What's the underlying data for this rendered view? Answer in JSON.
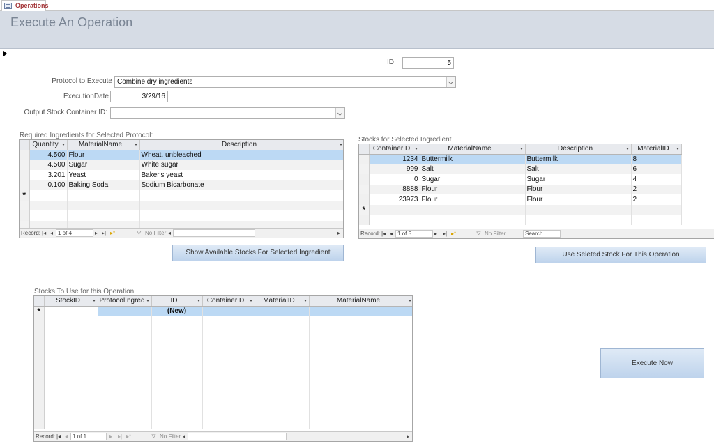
{
  "tab": {
    "label": "Operations",
    "icon": "form-icon"
  },
  "header": {
    "title": "Execute An Operation"
  },
  "fields": {
    "id_label": "ID",
    "id_value": "5",
    "protocol_label": "Protocol to Execute",
    "protocol_value": "Combine dry ingredients",
    "date_label": "ExecutionDate",
    "date_value": "3/29/16",
    "output_label": "Output Stock Container ID:",
    "output_value": ""
  },
  "ingredients": {
    "title": "Required Ingredients for Selected Protocol:",
    "columns": [
      "Quantity",
      "MaterialName",
      "Description"
    ],
    "rows": [
      [
        "4.500",
        "Flour",
        "Wheat, unbleached"
      ],
      [
        "4.500",
        "Sugar",
        "White sugar"
      ],
      [
        "3.201",
        "Yeast",
        "Baker's yeast"
      ],
      [
        "0.100",
        "Baking Soda",
        "Sodium Bicarbonate"
      ]
    ],
    "nav": {
      "record": "Record:",
      "position": "1 of 4",
      "filter": "No Filter"
    }
  },
  "stocks": {
    "title": "Stocks for Selected Ingredient",
    "columns": [
      "ContainerID",
      "MaterialName",
      "Description",
      "MaterialID"
    ],
    "rows": [
      [
        "1234",
        "Buttermilk",
        "Buttermilk",
        "8"
      ],
      [
        "999",
        "Salt",
        "Salt",
        "6"
      ],
      [
        "0",
        "Sugar",
        "Sugar",
        "4"
      ],
      [
        "8888",
        "Flour",
        "Flour",
        "2"
      ],
      [
        "23973",
        "Flour",
        "Flour",
        "2"
      ]
    ],
    "nav": {
      "record": "Record:",
      "position": "1 of 5",
      "filter": "No Filter",
      "search": "Search"
    }
  },
  "use_stocks": {
    "title": "Stocks To Use for this Operation",
    "columns": [
      "StockID",
      "ProtocolIngred",
      "ID",
      "ContainerID",
      "MaterialID",
      "MaterialName"
    ],
    "new_row_id": "(New)",
    "nav": {
      "record": "Record:",
      "position": "1 of 1",
      "filter": "No Filter"
    }
  },
  "buttons": {
    "show_stocks": "Show Available Stocks For Selected Ingredient",
    "use_stock": "Use Seleted Stock For This Operation",
    "execute": "Execute Now"
  },
  "new_record_marker": "*",
  "colors": {
    "header_bg": "#d6dce5",
    "selected_row": "#bcd9f4",
    "button": "#c9dbef",
    "tab_text": "#a4373a"
  }
}
